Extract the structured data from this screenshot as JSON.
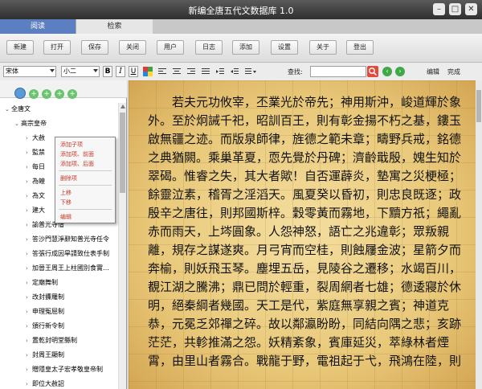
{
  "window": {
    "title": "新编全唐五代文数据库 1.0"
  },
  "tabs": [
    {
      "label": "阅读"
    },
    {
      "label": "检索"
    }
  ],
  "toolbar": {
    "buttons": [
      {
        "label": "新建"
      },
      {
        "label": "打开"
      },
      {
        "label": "保存"
      },
      {
        "label": "关闭"
      },
      {
        "label": "用户"
      },
      {
        "label": "日志"
      },
      {
        "label": "添加"
      },
      {
        "label": "设置"
      },
      {
        "label": "关于"
      },
      {
        "label": "登出"
      }
    ]
  },
  "format": {
    "font": "宋体",
    "size": "小二",
    "bold": "B",
    "italic": "I",
    "underline": "U",
    "search_label": "查找:",
    "edit_label": "编辑",
    "done_label": "完成"
  },
  "tree": {
    "root": "全唐文",
    "parent": "高宗皇帝",
    "items": [
      "大赦",
      "監禁",
      "每日",
      "為蝗",
      "為文",
      "建大",
      "諭普光寺僧",
      "答沙門慧淨辭知普光寺任令",
      "答張行成因旱請致仕表手制",
      "加晉王周王上柱國別食實…",
      "定廟舞制",
      "改封攈羅制",
      "申理冤屈制",
      "頒行新令制",
      "置乾封明堂縣制",
      "封周王顯制",
      "贈隱皇太子宏孝敬皇帝制",
      "即位大赦詔"
    ]
  },
  "context_menu": {
    "items": [
      "添加子项",
      "添加项、前面",
      "添加项、后面",
      "删除项",
      "上移",
      "下移",
      "编辑"
    ]
  },
  "reader": {
    "text": "若夫元功攸宰，丕業光於帝先；神用斯沖，峻道輝於象外。至於炯誡千祀，昭訓百王，則有彰金揚不朽之基，鏤玉啟無疆之迹。而版泉師律，旌德之範未章；疇野兵戒，銘德之典猶闕。乘巢革夏，恧先覺於丹碑；濟齡戢殷，媿生知於翠碣。惟睿之失，其大者歟！自否運薜炎，墊寓之災梗極；餘靈泣素，稽胥之淫滔天。風夏癸以昏初，則忠良既逐；政殷辛之唐往，則邦國斯梓。穀零黃而霧地，下黷方祇；繩亂赤而雨天，上埁圓象。人怨神怒，語亡之兆違彰；眾叛親離，規存之謀遂爽。月弓宵而空桂，則蝕屨金波；星箭夕而奔榆，則妖飛玉琴。塵埋五岳，見陵谷之遷移；水竭百川，覩江湖之騰沸；鼎已問於輕重，裂周網者七雄；德逶寢於休明，絕秦綱者幾國。天工是代，紫庭無享親之賓；神道克恭，元冕乏郊禪之碎。故以鄰瀛盼盼，同結向隅之悲；亥跡茫茫，共軫推滿之怨。妖精紊象，賓庫延災，萃綠林者煙霄，由里山者霧合。戰龍于野，電祖起于弋，飛鴻在陸，則"
  }
}
